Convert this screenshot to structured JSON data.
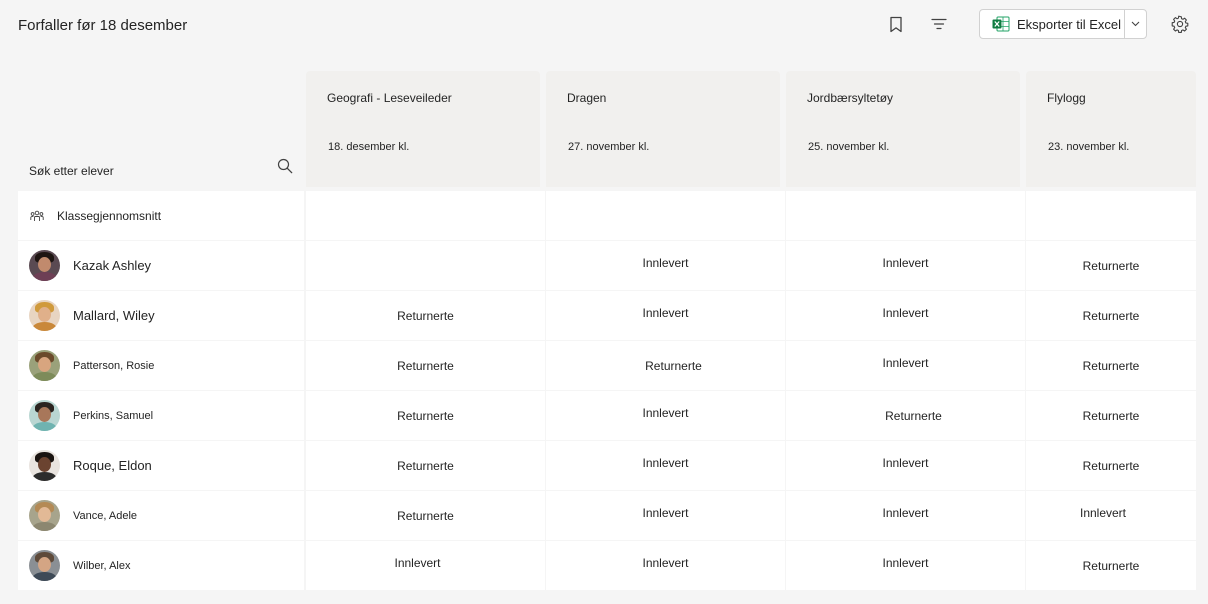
{
  "header": {
    "title": "Forfaller før 18 desember",
    "export_label": "Eksporter til Excel",
    "excel_color": "#107c41"
  },
  "search": {
    "placeholder": "Søk etter elever"
  },
  "assignments": [
    {
      "name": "Geografi - Leseveileder",
      "date": "18. desember kl."
    },
    {
      "name": "Dragen",
      "date": "27. november kl."
    },
    {
      "name": "Jordbærsyltetøy",
      "date": "25. november kl."
    },
    {
      "name": "Flylogg",
      "date": "23. november kl."
    }
  ],
  "class_average": {
    "label": "Klassegjennomsnitt",
    "values": [
      "",
      "",
      "",
      ""
    ]
  },
  "students": [
    {
      "name": "Kazak Ashley",
      "status": [
        "",
        "Innlevert",
        "Innlevert",
        "Returnerte"
      ]
    },
    {
      "name": "Mallard, Wiley",
      "status": [
        "Returnerte",
        "Innlevert",
        "Innlevert",
        "Returnerte"
      ]
    },
    {
      "name": "Patterson, Rosie",
      "status": [
        "Returnerte",
        "Returnerte",
        "Innlevert",
        "Returnerte"
      ]
    },
    {
      "name": "Perkins, Samuel",
      "status": [
        "Returnerte",
        "Innlevert",
        "Returnerte",
        "Returnerte"
      ]
    },
    {
      "name": "Roque, Eldon",
      "status": [
        "Returnerte",
        "Innlevert",
        "Innlevert",
        "Returnerte"
      ]
    },
    {
      "name": "Vance, Adele",
      "status": [
        "Returnerte",
        "Innlevert",
        "Innlevert",
        "Innlevert"
      ]
    },
    {
      "name": "Wilber, Alex",
      "status": [
        "Innlevert",
        "Innlevert",
        "Innlevert",
        "Returnerte"
      ]
    }
  ]
}
